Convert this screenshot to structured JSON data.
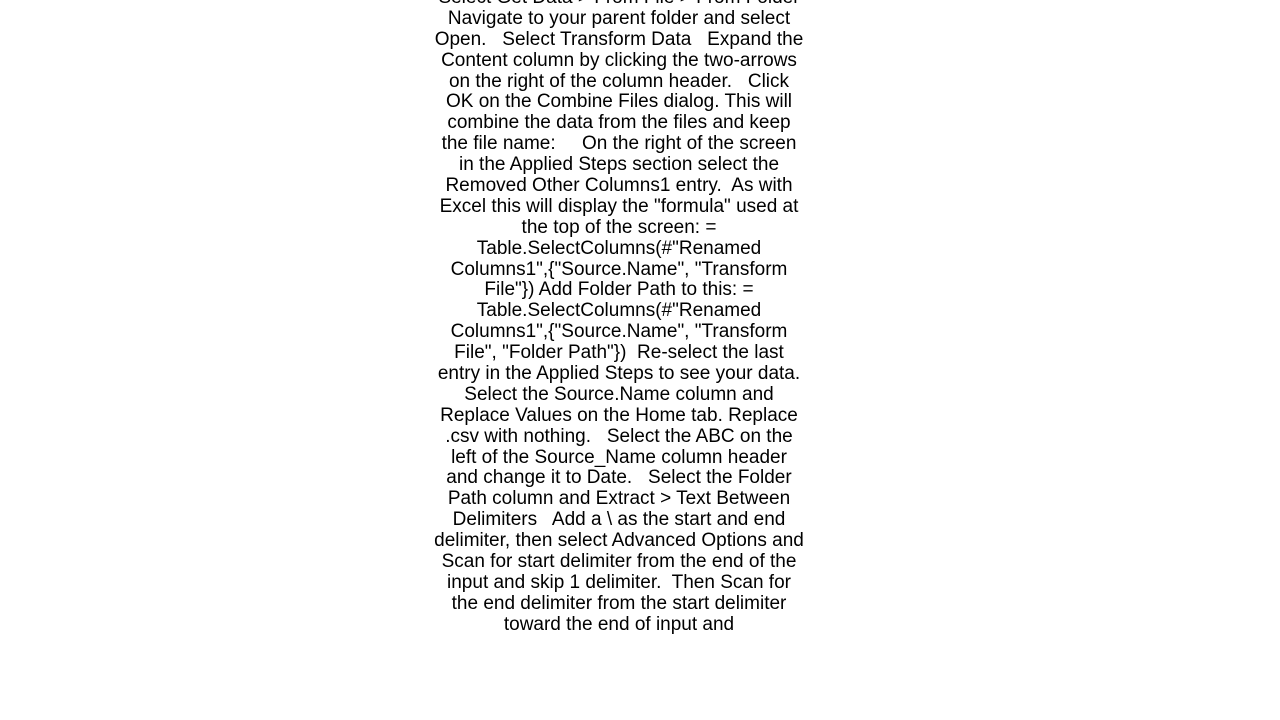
{
  "document": {
    "body": "Select Get Data > From File > From Folder   Navigate to your parent folder and select Open.   Select Transform Data   Expand the Content column by clicking the two-arrows on the right of the column header.   Click OK on the Combine Files dialog. This will combine the data from the files and keep the file name:     On the right of the screen in the Applied Steps section select the Removed Other Columns1 entry.  As with Excel this will display the \"formula\" used at the top of the screen: = Table.SelectColumns(#\"Renamed Columns1\",{\"Source.Name\", \"Transform File\"}) Add Folder Path to this: = Table.SelectColumns(#\"Renamed Columns1\",{\"Source.Name\", \"Transform File\", \"Folder Path\"})  Re-select the last entry in the Applied Steps to see your data.   Select the Source.Name column and Replace Values on the Home tab. Replace .csv with nothing.   Select the ABC on the left of the Source_Name column header and change it to Date.   Select the Folder Path column and Extract > Text Between Delimiters   Add a \\ as the start and end delimiter, then select Advanced Options and Scan for start delimiter from the end of the input and skip 1 delimiter.  Then Scan for the end delimiter from the start delimiter toward the end of input and"
  }
}
